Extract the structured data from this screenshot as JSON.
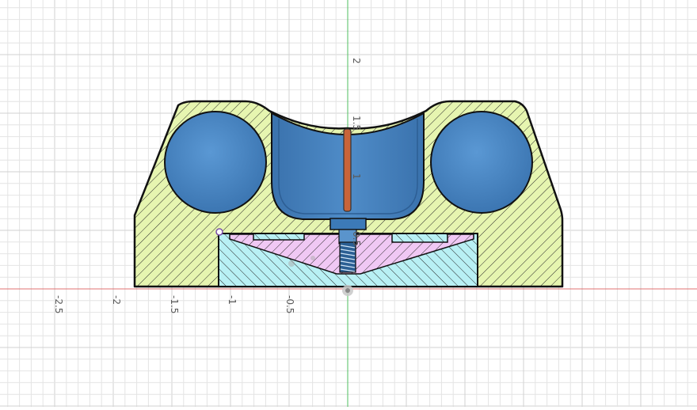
{
  "canvas": {
    "title": "",
    "background": "#ffffff",
    "grid_color": "#e4e4e4",
    "grid_major_color": "#d2d2d2",
    "x_axis_color": "#e07070",
    "y_axis_color": "#4fbf5f"
  },
  "axes": {
    "x_ticks": [
      "-2.5",
      "-2",
      "-1.5",
      "-1",
      "-0.5"
    ],
    "y_ticks": [
      "2",
      "1.5",
      "1",
      "0.5"
    ]
  },
  "parts": {
    "housing": {
      "fill": "#e6f5b0",
      "hatch": "#2a2a2a"
    },
    "base_insert": {
      "fill": "#b8f0f4"
    },
    "cone_insert": {
      "fill": "#f0c8f4"
    },
    "cup": {
      "fill": "#4a86c2",
      "dark": "#2d5e94"
    },
    "ball": {
      "fill": "#4a86c2"
    },
    "pin": {
      "fill": "#c8643a"
    },
    "screw": {
      "fill": "#3c7ab8"
    }
  },
  "icons": {
    "origin": "origin-point-icon",
    "sketch_point": "sketch-point-icon"
  }
}
